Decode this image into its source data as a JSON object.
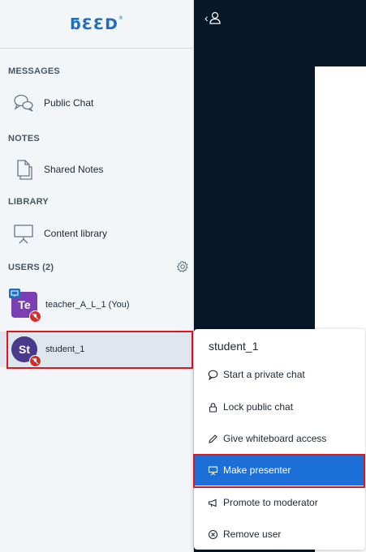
{
  "logo": {
    "text": "ƃƐƐD",
    "mark": "®"
  },
  "sections": {
    "messages": "MESSAGES",
    "notes": "NOTES",
    "library": "LIBRARY",
    "users": "USERS (2)"
  },
  "nav": {
    "public_chat": "Public Chat",
    "shared_notes": "Shared Notes",
    "content_library": "Content library"
  },
  "users": [
    {
      "initials": "Te",
      "name": "teacher_A_L_1 (You)",
      "presenter": true,
      "muted": true
    },
    {
      "initials": "St",
      "name": "student_1",
      "presenter": false,
      "muted": true,
      "selected": true
    }
  ],
  "context_menu": {
    "title": "student_1",
    "items": [
      {
        "label": "Start a private chat",
        "icon": "chat-bubble-icon"
      },
      {
        "label": "Lock public chat",
        "icon": "lock-icon"
      },
      {
        "label": "Give whiteboard access",
        "icon": "pencil-icon"
      },
      {
        "label": "Make presenter",
        "icon": "presenter-screen-icon",
        "active": true
      },
      {
        "label": "Promote to moderator",
        "icon": "megaphone-icon"
      },
      {
        "label": "Remove user",
        "icon": "remove-circle-icon"
      }
    ]
  },
  "topbar": {
    "icon": "collapse-user-list-icon",
    "glyph": "‹"
  },
  "colors": {
    "accent": "#1b6fd6",
    "dark_bg": "#06172a",
    "sidebar_bg": "#f3f6f9",
    "highlight": "#e0151d",
    "avatar_teacher": "#7b3fb3",
    "avatar_student": "#4a3a8c",
    "mute_badge": "#d72c2c"
  }
}
